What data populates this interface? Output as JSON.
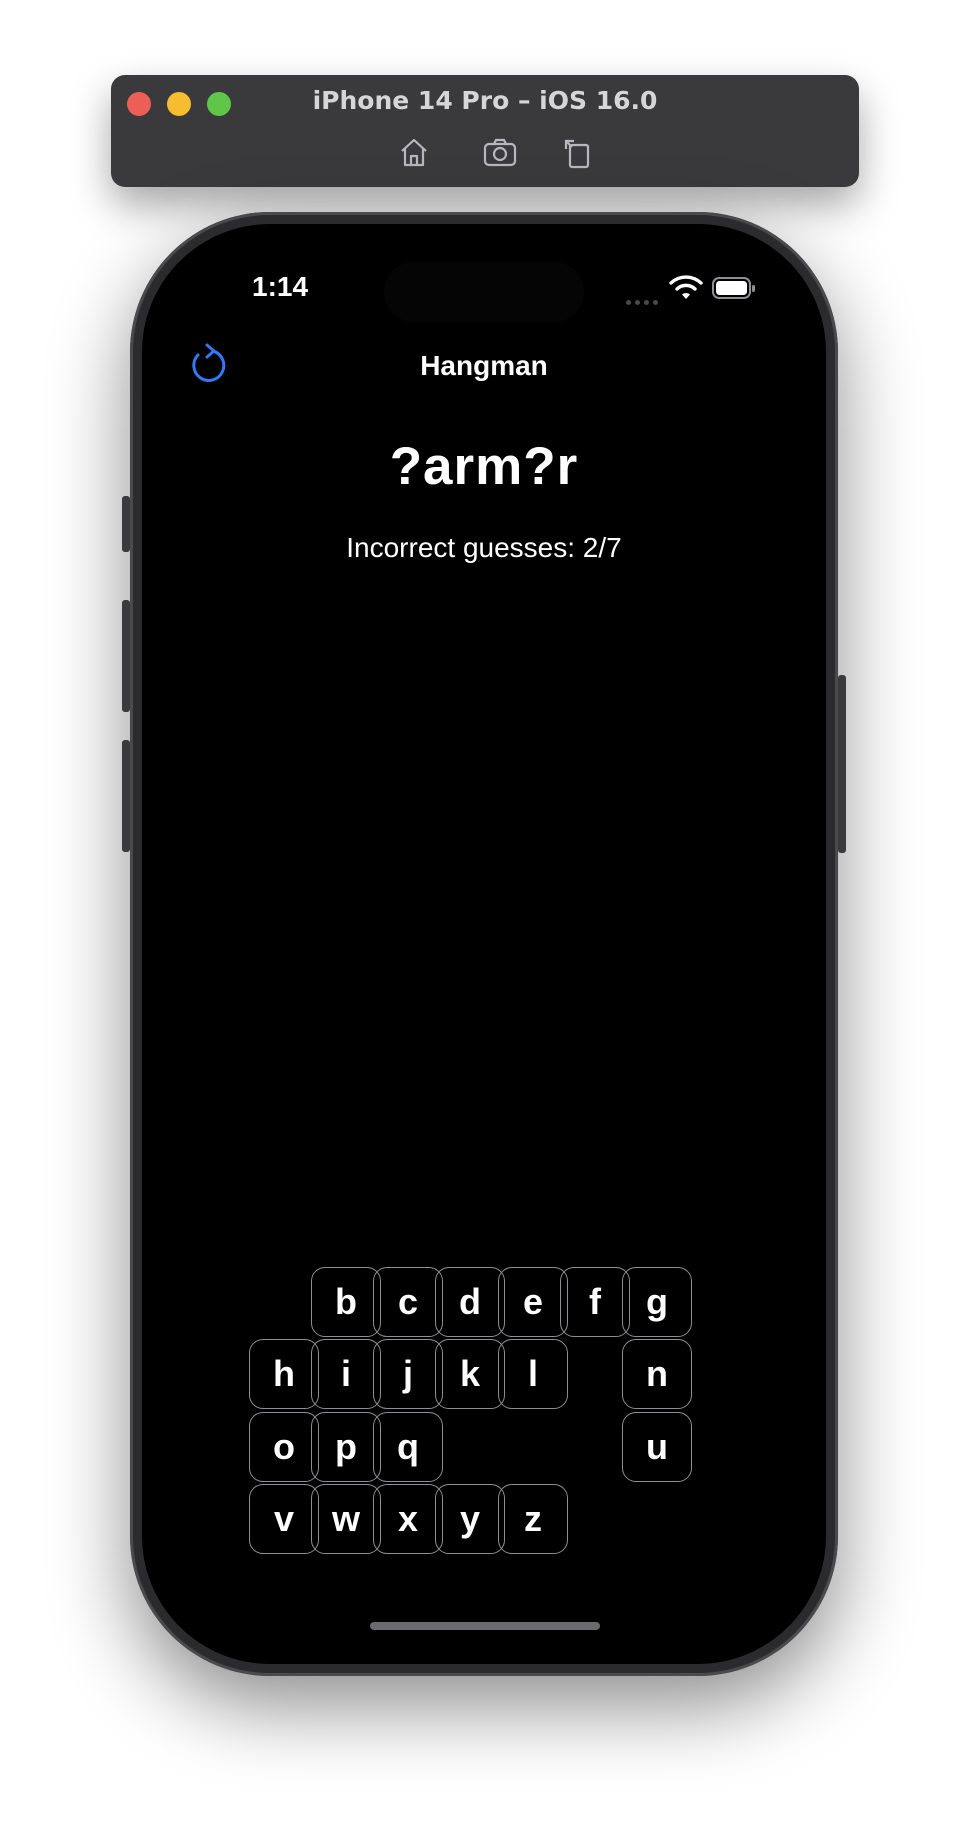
{
  "simulator": {
    "title": "iPhone 14 Pro – iOS 16.0",
    "toolbar_icons": [
      "home-icon",
      "screenshot-icon",
      "rotate-icon"
    ]
  },
  "status_bar": {
    "time": "1:14",
    "icons": [
      "cellular-icon",
      "wifi-icon",
      "battery-icon"
    ]
  },
  "nav": {
    "title": "Hangman",
    "refresh_icon": "refresh-icon",
    "accent_color": "#3478f6"
  },
  "game": {
    "word": "?arm?r",
    "incorrect_guesses": "Incorrect guesses: 2/7"
  },
  "keyboard": {
    "row1": [
      "b",
      "c",
      "d",
      "e",
      "f",
      "g"
    ],
    "row2": [
      "h",
      "i",
      "j",
      "k",
      "l",
      "n"
    ],
    "row3": [
      "o",
      "p",
      "q",
      "u"
    ],
    "row4": [
      "v",
      "w",
      "x",
      "y",
      "z"
    ]
  }
}
